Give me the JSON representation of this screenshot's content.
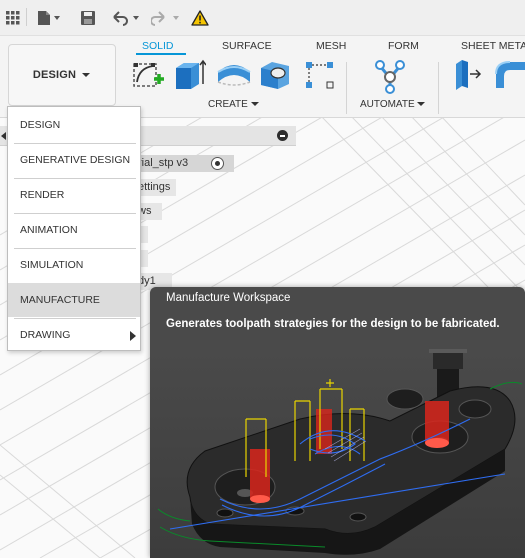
{
  "quick_access": {
    "icons": [
      "grid-icon",
      "file-icon",
      "save-icon",
      "undo-icon",
      "redo-icon",
      "warning-icon"
    ]
  },
  "ribbon": {
    "workspace_label": "DESIGN",
    "tabs": [
      {
        "label": "SOLID",
        "active": true
      },
      {
        "label": "SURFACE",
        "active": false
      },
      {
        "label": "MESH",
        "active": false
      },
      {
        "label": "FORM",
        "active": false
      },
      {
        "label": "SHEET METAL",
        "active": false
      }
    ],
    "groups": [
      {
        "label": "CREATE"
      },
      {
        "label": "AUTOMATE"
      }
    ]
  },
  "browser": {
    "fragments": [
      "rial_stp v3",
      "ettings",
      "ws",
      "",
      "",
      "dy1"
    ]
  },
  "workspace_menu": {
    "items": [
      {
        "label": "DESIGN",
        "highlighted": false
      },
      {
        "label": "GENERATIVE DESIGN",
        "highlighted": false
      },
      {
        "label": "RENDER",
        "highlighted": false
      },
      {
        "label": "ANIMATION",
        "highlighted": false
      },
      {
        "label": "SIMULATION",
        "highlighted": false
      },
      {
        "label": "MANUFACTURE",
        "highlighted": true
      },
      {
        "label": "DRAWING",
        "highlighted": false
      }
    ]
  },
  "tooltip": {
    "title": "Manufacture Workspace",
    "description": "Generates toolpath strategies for the design to be fabricated."
  },
  "colors": {
    "accent": "#0696d7",
    "tooltip_bg": "#4a4a4a",
    "warning": "#f5c400",
    "sketch_green": "#22aa22"
  }
}
